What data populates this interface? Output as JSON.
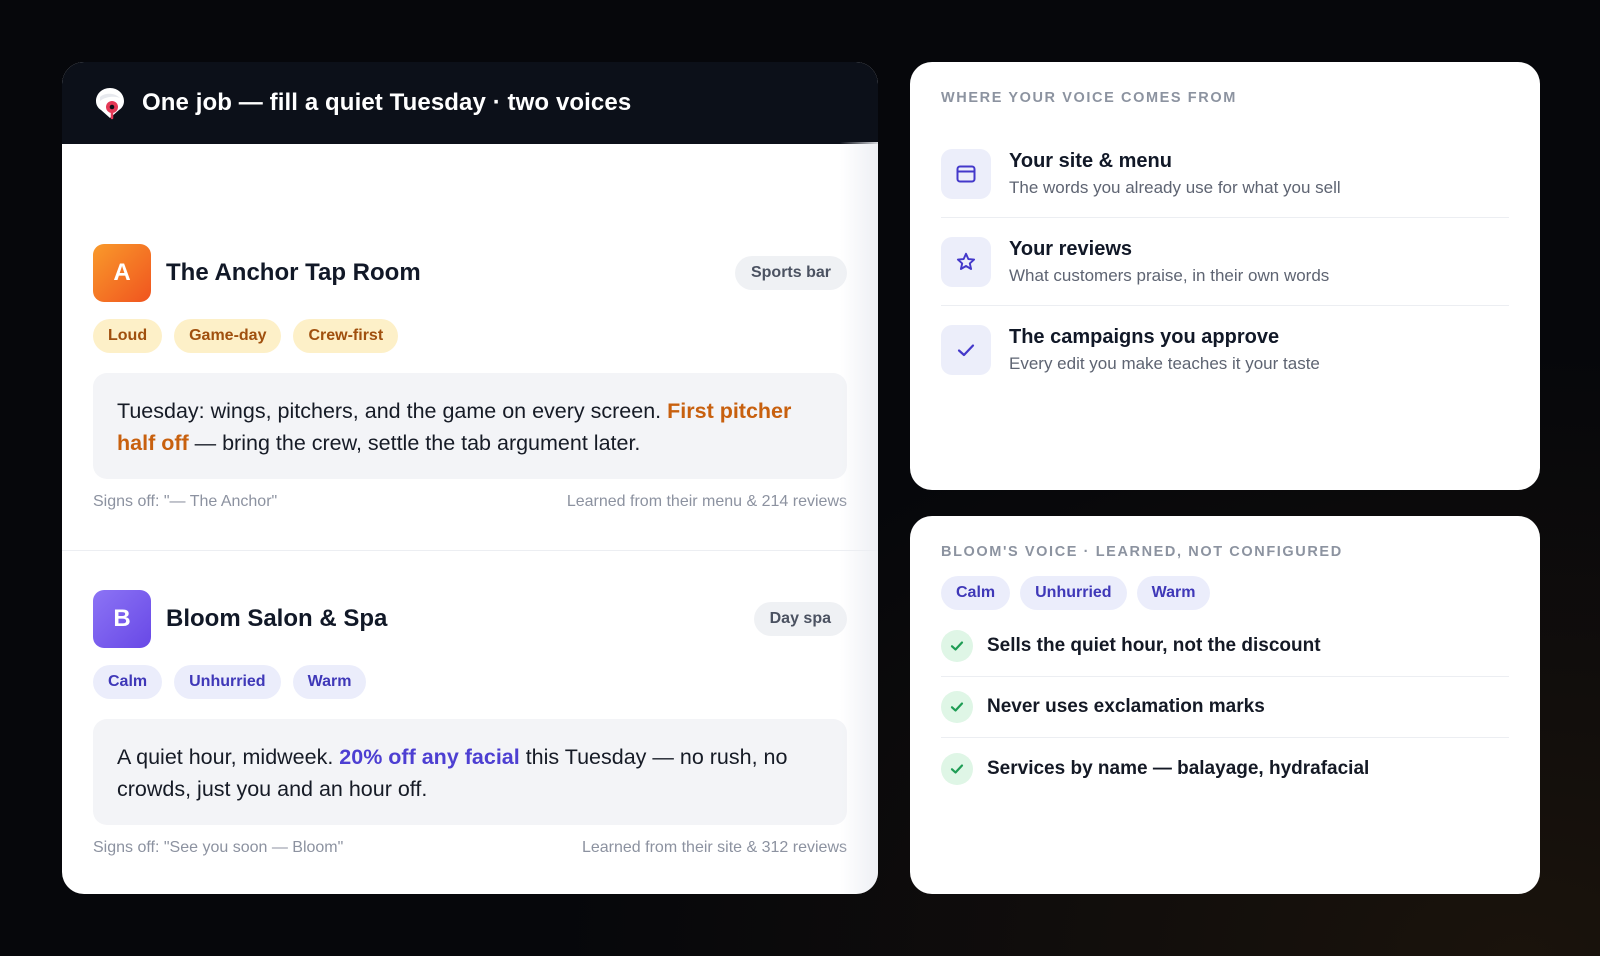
{
  "header": {
    "title": "One job — fill a quiet Tuesday · two voices",
    "logo_icon": "map-pin-icon"
  },
  "businesses": [
    {
      "avatar_letter": "A",
      "name": "The Anchor Tap Room",
      "type": "Sports bar",
      "tags": [
        "Loud",
        "Game-day",
        "Crew-first"
      ],
      "message": {
        "before": "Tuesday: wings, pitchers, and the game on every screen. ",
        "highlight": "First pitcher half off",
        "after": " — bring the crew, settle the tab argument later."
      },
      "signoff": "Signs off: \"— The Anchor\"",
      "learned_from": "Learned from their menu & 214 reviews",
      "accent_color": "#c8600e"
    },
    {
      "avatar_letter": "B",
      "name": "Bloom Salon & Spa",
      "type": "Day spa",
      "tags": [
        "Calm",
        "Unhurried",
        "Warm"
      ],
      "message": {
        "before": "A quiet hour, midweek. ",
        "highlight": "20% off any facial",
        "after": " this Tuesday — no rush, no crowds, just you and an hour off."
      },
      "signoff": "Signs off: \"See you soon — Bloom\"",
      "learned_from": "Learned from their site & 312 reviews",
      "accent_color": "#4d3fd2"
    }
  ],
  "voice_sources": {
    "label": "WHERE YOUR VOICE COMES FROM",
    "items": [
      {
        "icon": "browser-window-icon",
        "title": "Your site & menu",
        "subtitle": "The words you already use for what you sell"
      },
      {
        "icon": "star-icon",
        "title": "Your reviews",
        "subtitle": "What customers praise, in their own words"
      },
      {
        "icon": "checkmark-icon",
        "title": "The campaigns you approve",
        "subtitle": "Every edit you make teaches it your taste"
      }
    ]
  },
  "bloom_voice": {
    "label": "BLOOM'S VOICE · LEARNED, NOT CONFIGURED",
    "tags": [
      "Calm",
      "Unhurried",
      "Warm"
    ],
    "rules": [
      "Sells the quiet hour, not the discount",
      "Never uses exclamation marks",
      "Services by name — balayage, hydrafacial"
    ]
  },
  "colors": {
    "background": "#06070b",
    "header_bg": "#0c1019",
    "warm_tag_bg": "#fdf0c8",
    "warm_tag_text": "#a0500e",
    "cool_tag_bg": "#ebedfb",
    "cool_tag_text": "#3f38b8",
    "check_green": "#1f9d55"
  }
}
